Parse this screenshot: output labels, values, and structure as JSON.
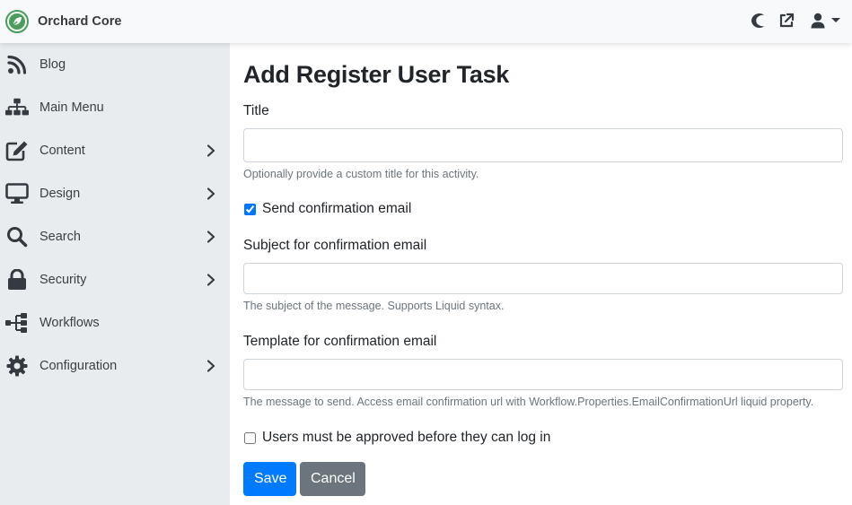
{
  "app": {
    "brand_name": "Orchard Core",
    "brand_color": "#4a9d5b"
  },
  "topbar": {
    "theme_toggle_icon": "moon-icon",
    "visit_site_icon": "external-link-icon",
    "user_menu_icon": "user-icon"
  },
  "sidebar": {
    "items": [
      {
        "label": "Blog",
        "icon": "rss-icon",
        "has_submenu": false
      },
      {
        "label": "Main Menu",
        "icon": "sitemap-icon",
        "has_submenu": false
      },
      {
        "label": "Content",
        "icon": "edit-icon",
        "has_submenu": true
      },
      {
        "label": "Design",
        "icon": "desktop-icon",
        "has_submenu": true
      },
      {
        "label": "Search",
        "icon": "search-icon",
        "has_submenu": true
      },
      {
        "label": "Security",
        "icon": "lock-icon",
        "has_submenu": true
      },
      {
        "label": "Workflows",
        "icon": "workflow-icon",
        "has_submenu": false
      },
      {
        "label": "Configuration",
        "icon": "gear-icon",
        "has_submenu": true
      }
    ]
  },
  "form": {
    "page_title": "Add Register User Task",
    "title_field": {
      "label": "Title",
      "value": "",
      "hint": "Optionally provide a custom title for this activity."
    },
    "send_confirmation": {
      "label": "Send confirmation email",
      "checked": true
    },
    "subject_field": {
      "label": "Subject for confirmation email",
      "value": "",
      "hint": "The subject of the message. Supports Liquid syntax."
    },
    "template_field": {
      "label": "Template for confirmation email",
      "value": "",
      "hint": "The message to send. Access email confirmation url with Workflow.Properties.EmailConfirmationUrl liquid property."
    },
    "require_approval": {
      "label": "Users must be approved before they can log in",
      "checked": false
    },
    "save_label": "Save",
    "cancel_label": "Cancel"
  },
  "colors": {
    "primary": "#007bff",
    "secondary": "#6c757d",
    "sidebar_bg": "#e9ecef",
    "topbar_bg": "#f8f9fa"
  }
}
